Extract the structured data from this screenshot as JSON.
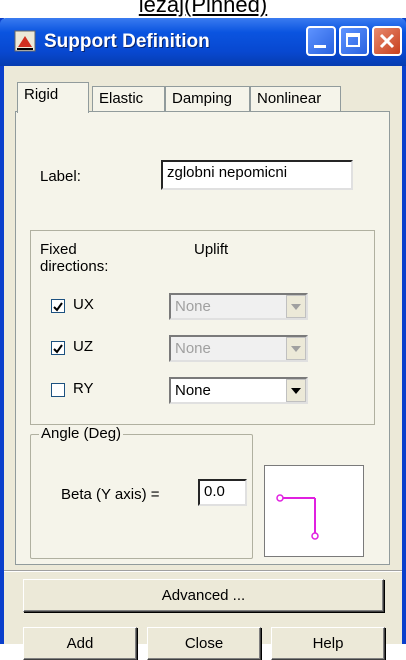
{
  "heading": "lezaj(Pinned)",
  "window": {
    "title": "Support Definition"
  },
  "tabs": [
    {
      "label": "Rigid",
      "active": true
    },
    {
      "label": "Elastic",
      "active": false
    },
    {
      "label": "Damping",
      "active": false
    },
    {
      "label": "Nonlinear",
      "active": false
    }
  ],
  "form": {
    "label_caption": "Label:",
    "label_value": "zglobni nepomicni"
  },
  "fixed": {
    "caption": "Fixed directions:",
    "uplift_caption": "Uplift",
    "rows": [
      {
        "name": "UX",
        "checked": true,
        "uplift": "None",
        "enabled": false
      },
      {
        "name": "UZ",
        "checked": true,
        "uplift": "None",
        "enabled": false
      },
      {
        "name": "RY",
        "checked": false,
        "uplift": "None",
        "enabled": true
      }
    ]
  },
  "angle": {
    "caption": "Angle (Deg)",
    "beta_label": "Beta (Y axis) =",
    "beta_value": "0.0"
  },
  "buttons": {
    "advanced": "Advanced ...",
    "add": "Add",
    "close": "Close",
    "help": "Help"
  },
  "colors": {
    "title_bar": "#0a54e0",
    "preview_stroke": "#e020e0"
  },
  "icons": [
    "support-icon",
    "minimize-icon",
    "maximize-icon",
    "close-icon",
    "dropdown-arrow-icon"
  ]
}
